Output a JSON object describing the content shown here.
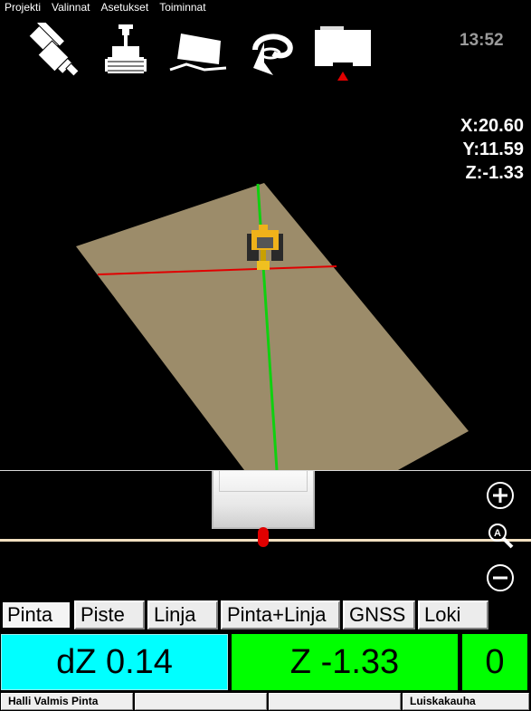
{
  "menu": {
    "items": [
      "Projekti",
      "Valinnat",
      "Asetukset",
      "Toiminnat"
    ]
  },
  "toolbar": {
    "icons": [
      "excavator-top-view-icon",
      "excavator-front-view-icon",
      "bucket-profile-icon",
      "rotate-view-icon",
      "display-mode-icon"
    ],
    "clock": "13:52"
  },
  "position": {
    "x": "X:20.60",
    "y": "Y:11.59",
    "z": "Z:-1.33"
  },
  "tabs": [
    "Pinta",
    "Piste",
    "Linja",
    "Pinta+Linja",
    "GNSS",
    "Loki"
  ],
  "active_tab": "Pinta",
  "readouts": {
    "dz": "dZ 0.14",
    "z": "Z -1.33",
    "count": "0"
  },
  "status": {
    "left": "Halli Valmis Pinta",
    "mid1": "",
    "mid2": "",
    "right": "Luiskakauha"
  },
  "colors": {
    "surface": "#9c8c6a",
    "dz_bg": "#00ffff",
    "z_bg": "#00ff00",
    "axis_x": "#e00000",
    "axis_y": "#10d010"
  }
}
